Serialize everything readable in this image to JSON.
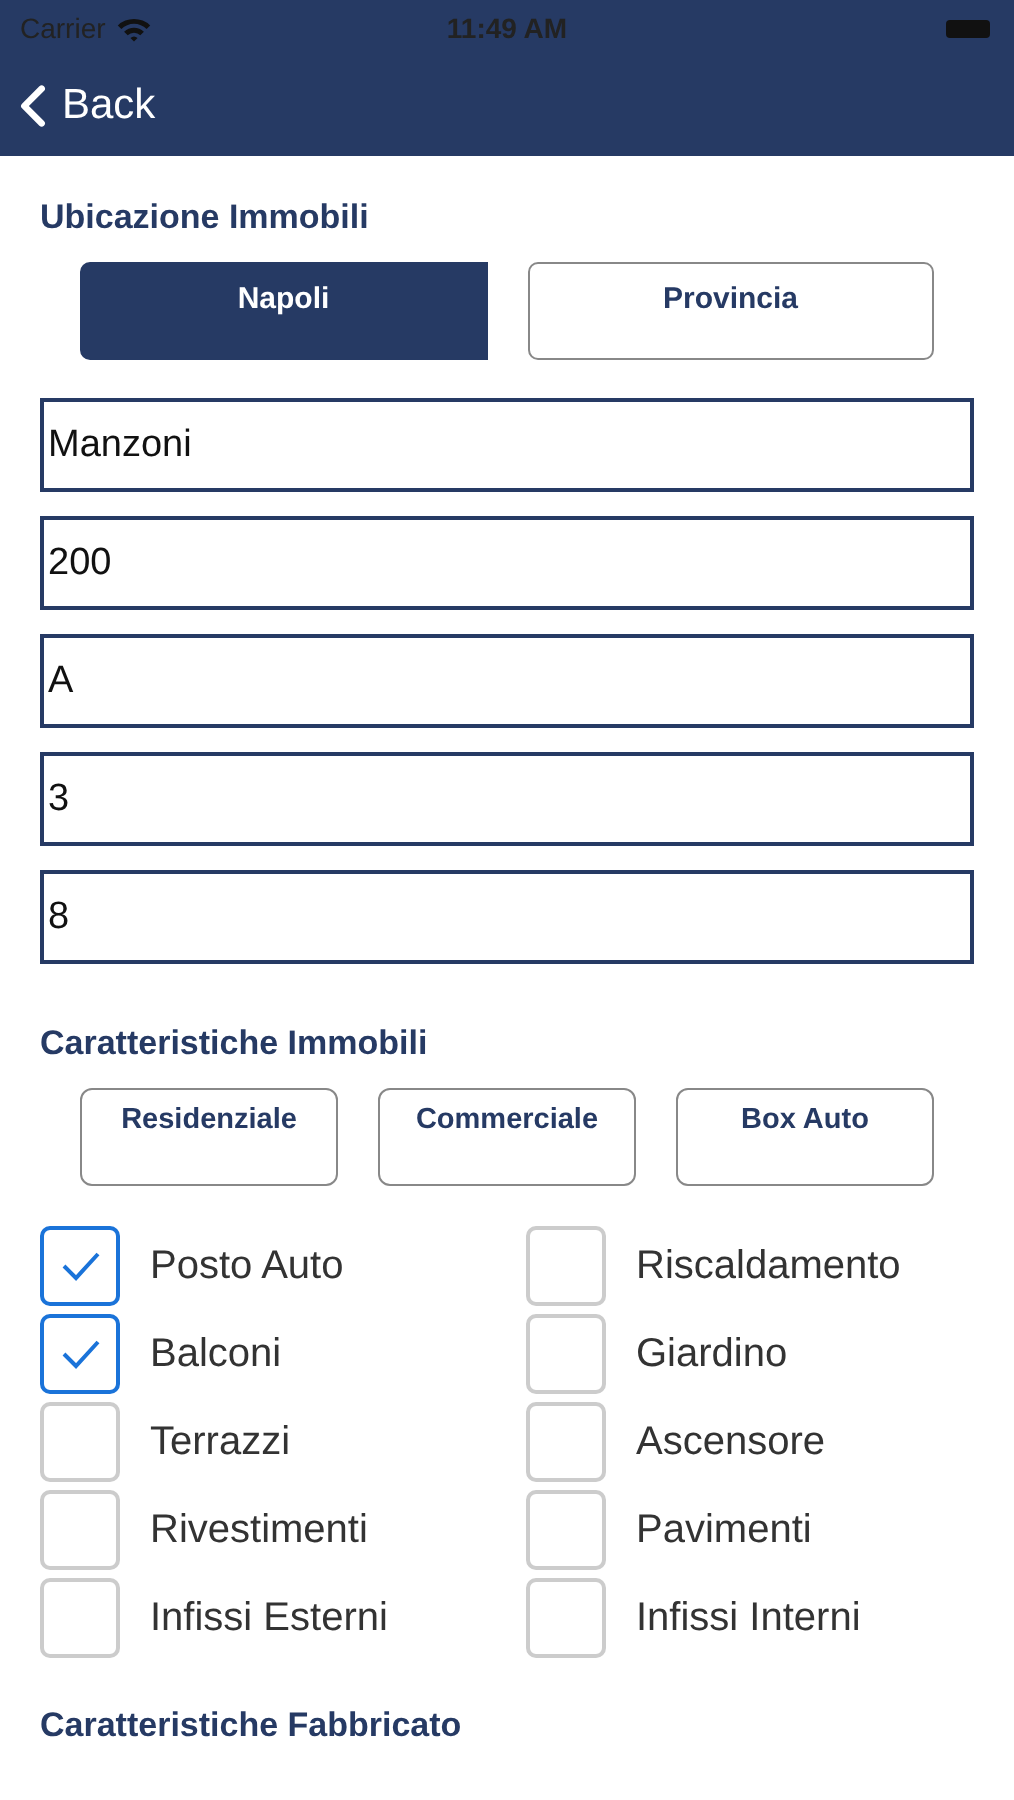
{
  "status_bar": {
    "carrier": "Carrier",
    "time": "11:49 AM"
  },
  "nav": {
    "back": "Back"
  },
  "location": {
    "title": "Ubicazione Immobili",
    "options": [
      {
        "label": "Napoli",
        "selected": true
      },
      {
        "label": "Provincia",
        "selected": false
      }
    ],
    "fields": [
      {
        "value": "Manzoni"
      },
      {
        "value": "200"
      },
      {
        "value": "A"
      },
      {
        "value": "3"
      },
      {
        "value": "8"
      }
    ]
  },
  "features": {
    "title": "Caratteristiche Immobili",
    "types": [
      {
        "label": "Residenziale",
        "selected": false
      },
      {
        "label": "Commerciale",
        "selected": false
      },
      {
        "label": "Box Auto",
        "selected": false
      }
    ],
    "checkboxes": [
      {
        "label": "Posto Auto",
        "checked": true
      },
      {
        "label": "Riscaldamento",
        "checked": false
      },
      {
        "label": "Balconi",
        "checked": true
      },
      {
        "label": "Giardino",
        "checked": false
      },
      {
        "label": "Terrazzi",
        "checked": false
      },
      {
        "label": "Ascensore",
        "checked": false
      },
      {
        "label": "Rivestimenti",
        "checked": false
      },
      {
        "label": "Pavimenti",
        "checked": false
      },
      {
        "label": "Infissi Esterni",
        "checked": false
      },
      {
        "label": "Infissi Interni",
        "checked": false
      }
    ]
  },
  "building": {
    "title": "Caratteristiche Fabbricato"
  }
}
